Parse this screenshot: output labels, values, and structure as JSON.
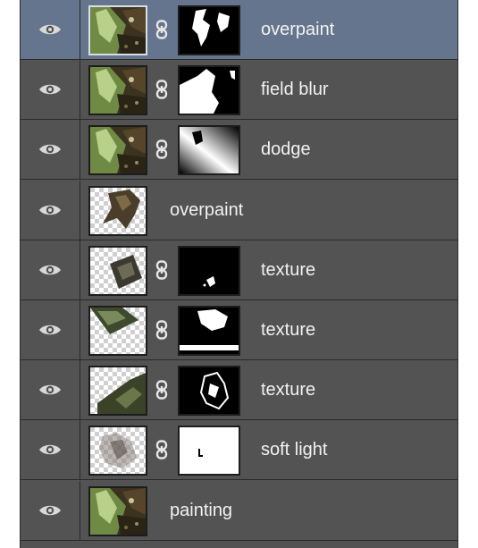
{
  "layers_panel": {
    "layers": [
      {
        "name": "overpaint",
        "selected": true,
        "has_mask": true,
        "thumb": "painting",
        "mask": "splatter"
      },
      {
        "name": "field blur",
        "selected": false,
        "has_mask": true,
        "thumb": "painting",
        "mask": "white-shape"
      },
      {
        "name": "dodge",
        "selected": false,
        "has_mask": true,
        "thumb": "painting",
        "mask": "gradient"
      },
      {
        "name": "overpaint",
        "selected": false,
        "has_mask": false,
        "thumb": "transparent-fragment",
        "mask": ""
      },
      {
        "name": "texture",
        "selected": false,
        "has_mask": true,
        "thumb": "transparent-tilted",
        "mask": "small-speck"
      },
      {
        "name": "texture",
        "selected": false,
        "has_mask": true,
        "thumb": "transparent-band",
        "mask": "splatter-bar"
      },
      {
        "name": "texture",
        "selected": false,
        "has_mask": true,
        "thumb": "transparent-corner",
        "mask": "scribble"
      },
      {
        "name": "soft light",
        "selected": false,
        "has_mask": true,
        "thumb": "transparent-sketch",
        "mask": "white-mark"
      },
      {
        "name": "painting",
        "selected": false,
        "has_mask": false,
        "thumb": "painting",
        "mask": ""
      }
    ],
    "colors": {
      "panel_bg": "#535353",
      "selected_bg": "#65758d",
      "divider": "#2a2a2a",
      "text": "#f2f2f2"
    },
    "icons": {
      "visibility": "eye-icon",
      "link": "chain-link-icon"
    }
  }
}
